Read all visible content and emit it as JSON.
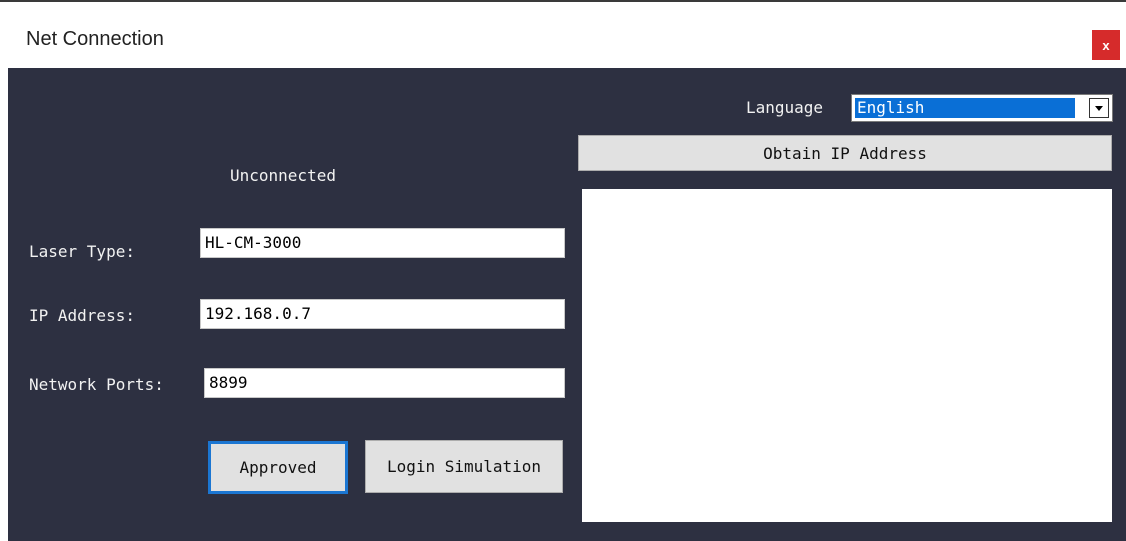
{
  "window": {
    "title": "Net Connection",
    "close_label": "x"
  },
  "status": {
    "text": "Unconnected"
  },
  "form": {
    "laser_type_label": "Laser Type:",
    "laser_type_value": "HL-CM-3000",
    "ip_address_label": "IP Address:",
    "ip_address_value": "192.168.0.7",
    "network_ports_label": "Network Ports:",
    "network_ports_value": "8899"
  },
  "buttons": {
    "approved_label": "Approved",
    "login_simulation_label": "Login Simulation",
    "obtain_ip_label": "Obtain IP Address"
  },
  "language": {
    "label": "Language",
    "selected": "English"
  },
  "ip_list": {
    "items": []
  },
  "colors": {
    "panel_background": "#2d3041",
    "close_button": "#d62b2b",
    "select_highlight": "#0a6fd6",
    "focus_border": "#1b76d2"
  },
  "icons": {
    "close": "close-icon",
    "dropdown": "chevron-down-icon"
  }
}
